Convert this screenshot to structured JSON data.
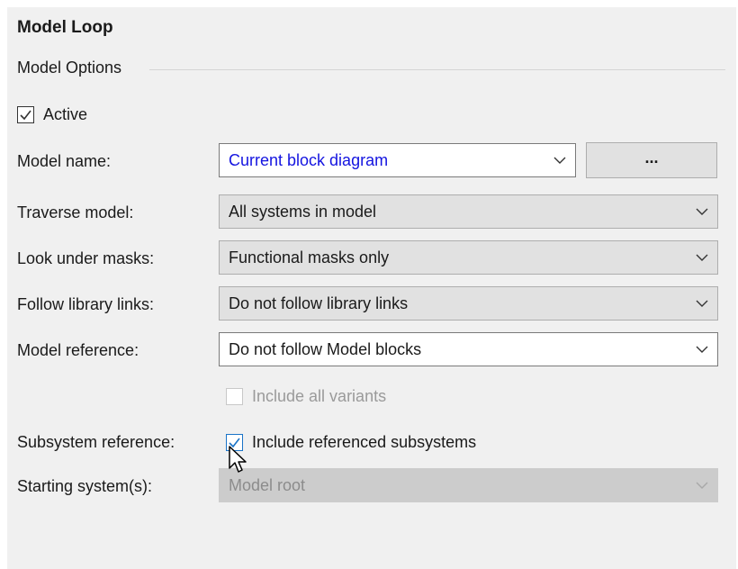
{
  "panel": {
    "title": "Model Loop"
  },
  "options_group": {
    "label": "Model Options"
  },
  "active": {
    "label": "Active",
    "checked": true
  },
  "model_name": {
    "label": "Model name:",
    "value": "Current block diagram",
    "browse_label": "..."
  },
  "traverse_model": {
    "label": "Traverse model:",
    "value": "All systems in model"
  },
  "look_under_masks": {
    "label": "Look under masks:",
    "value": "Functional masks only"
  },
  "follow_library_links": {
    "label": "Follow library links:",
    "value": "Do not follow library links"
  },
  "model_reference": {
    "label": "Model reference:",
    "value": "Do not follow Model blocks"
  },
  "include_all_variants": {
    "label": "Include all variants",
    "checked": false,
    "enabled": false
  },
  "subsystem_reference": {
    "label": "Subsystem reference:",
    "checkbox_label": "Include referenced subsystems",
    "checked": true
  },
  "starting_systems": {
    "label": "Starting system(s):",
    "value": "Model root",
    "enabled": false
  },
  "colors": {
    "panel_bg": "#f0f0f0",
    "combo_bg": "#e1e1e1",
    "link_blue": "#1414e0",
    "check_blue": "#1a73c7",
    "disabled_text": "#9a9a9a"
  },
  "icons": {
    "check": "check-icon",
    "dropdown": "chevron-down-icon",
    "cursor": "mouse-pointer-icon"
  }
}
